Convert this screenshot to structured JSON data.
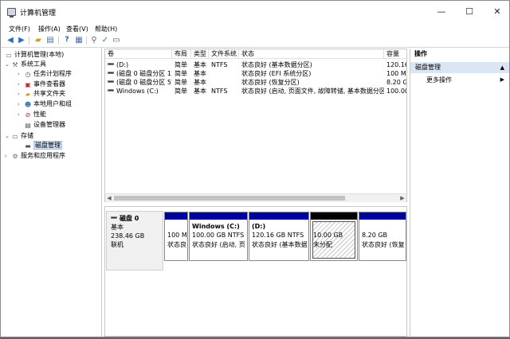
{
  "window": {
    "title": "计算机管理",
    "minimize": "—",
    "maximize": "☐",
    "close": "✕"
  },
  "menu": [
    "文件(F)",
    "操作(A)",
    "查看(V)",
    "帮助(H)"
  ],
  "tree": {
    "root": "计算机管理(本地)",
    "system_tools": "系统工具",
    "task_scheduler": "任务计划程序",
    "event_viewer": "事件查看器",
    "shared_folders": "共享文件夹",
    "local_users": "本地用户和组",
    "performance": "性能",
    "device_manager": "设备管理器",
    "storage": "存储",
    "disk_management": "磁盘管理",
    "services": "服务和应用程序"
  },
  "volumes": {
    "headers": [
      "卷",
      "布局",
      "类型",
      "文件系统",
      "状态",
      "容量"
    ],
    "rows": [
      {
        "name": "(D:)",
        "layout": "简单",
        "type": "基本",
        "fs": "NTFS",
        "status": "状态良好 (基本数据分区)",
        "cap": "120.16"
      },
      {
        "name": "(磁盘 0 磁盘分区 1)",
        "layout": "简单",
        "type": "基本",
        "fs": "",
        "status": "状态良好 (EFI 系统分区)",
        "cap": "100 ME"
      },
      {
        "name": "(磁盘 0 磁盘分区 5)",
        "layout": "简单",
        "type": "基本",
        "fs": "",
        "status": "状态良好 (恢复分区)",
        "cap": "8.20 GE"
      },
      {
        "name": "Windows (C:)",
        "layout": "简单",
        "type": "基本",
        "fs": "NTFS",
        "status": "状态良好 (启动, 页面文件, 故障转储, 基本数据分区)",
        "cap": "100.00"
      }
    ]
  },
  "disk": {
    "name": "磁盘 0",
    "type": "基本",
    "size": "238.46 GB",
    "status": "联机",
    "partitions": [
      {
        "title": "",
        "line1": "100 M",
        "line2": "状态良"
      },
      {
        "title": "Windows  (C:)",
        "line1": "100.00 GB NTFS",
        "line2": "状态良好 (启动, 页"
      },
      {
        "title": "(D:)",
        "line1": "120.16 GB NTFS",
        "line2": "状态良好 (基本数据"
      },
      {
        "title": "",
        "line1": "10.00 GB",
        "line2": "未分配"
      },
      {
        "title": "",
        "line1": "8.20 GB",
        "line2": "状态良好 (恢复"
      }
    ]
  },
  "actions": {
    "header": "操作",
    "section": "磁盘管理",
    "more": "更多操作"
  },
  "colors": {
    "primary_bar": "#00009c",
    "unallocated_bar": "#000000",
    "selection": "#cce4f7",
    "action_section": "#dbe6f4"
  }
}
